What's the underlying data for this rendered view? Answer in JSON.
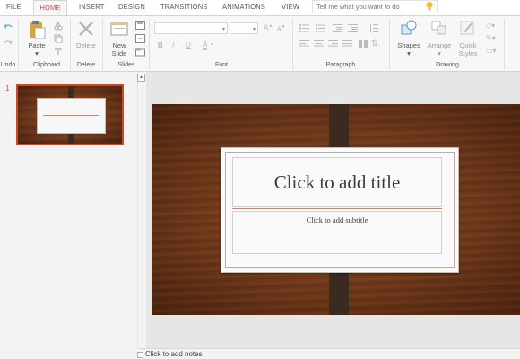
{
  "tabs": [
    {
      "label": "FILE",
      "active": false
    },
    {
      "label": "HOME",
      "active": true
    },
    {
      "label": "INSERT",
      "active": false
    },
    {
      "label": "DESIGN",
      "active": false
    },
    {
      "label": "TRANSITIONS",
      "active": false
    },
    {
      "label": "ANIMATIONS",
      "active": false
    },
    {
      "label": "VIEW",
      "active": false
    }
  ],
  "tell_me": {
    "placeholder": "Tell me what you want to do"
  },
  "ribbon": {
    "groups": {
      "undo": "Undo",
      "clipboard": "Clipboard",
      "delete": "Delete",
      "slides": "Slides",
      "font": "Font",
      "paragraph": "Paragraph",
      "drawing": "Drawing"
    },
    "buttons": {
      "paste": "Paste",
      "delete": "Delete",
      "new_slide_line1": "New",
      "new_slide_line2": "Slide",
      "shapes": "Shapes",
      "arrange": "Arrange",
      "quick_styles_line1": "Quick",
      "quick_styles_line2": "Styles"
    },
    "font_buttons": {
      "bold": "B",
      "italic": "I",
      "underline": "U",
      "font_color": "A"
    }
  },
  "thumbnails": [
    {
      "number": "1"
    }
  ],
  "slide": {
    "title_placeholder": "Click to add title",
    "subtitle_placeholder": "Click to add subtitle"
  },
  "notes": {
    "placeholder": "Click to add notes"
  },
  "colors": {
    "accent": "#c0504d",
    "thumb_border": "#d24726",
    "wood": "#6e3718",
    "strap": "#3a2a20"
  }
}
